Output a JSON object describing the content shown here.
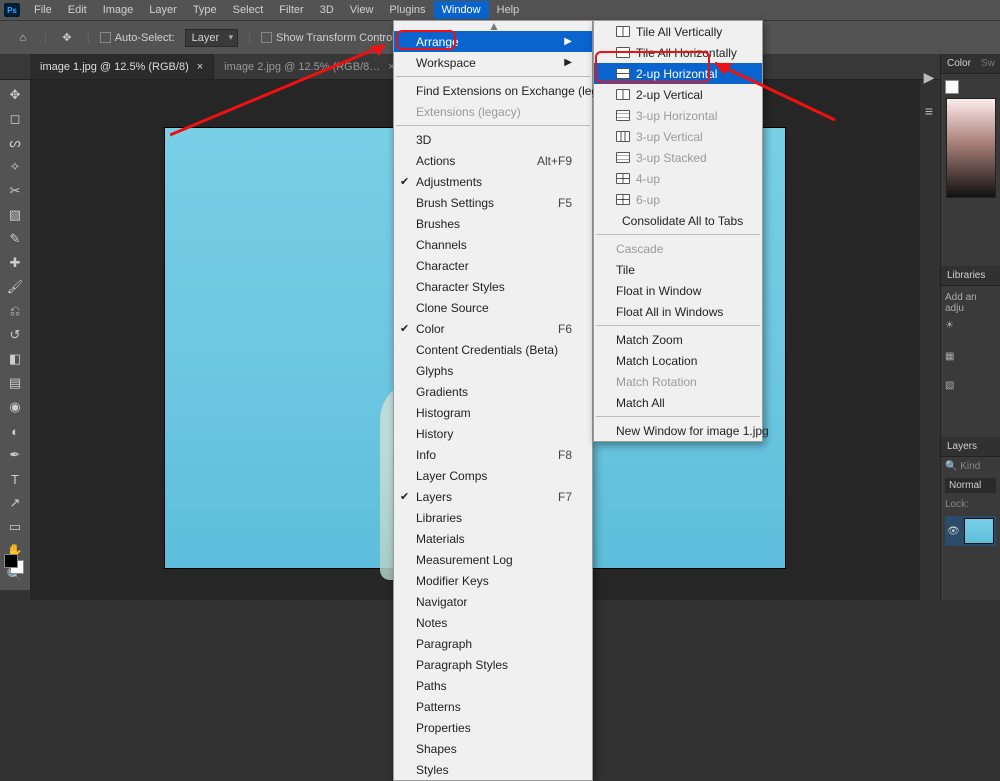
{
  "menubar": {
    "logo": "Ps",
    "items": [
      "File",
      "Edit",
      "Image",
      "Layer",
      "Type",
      "Select",
      "Filter",
      "3D",
      "View",
      "Plugins",
      "Window",
      "Help"
    ],
    "open_index": 10
  },
  "optbar": {
    "auto_select": "Auto-Select:",
    "select_target": "Layer",
    "show_transform": "Show Transform Controls"
  },
  "doctabs": [
    {
      "label": "image 1.jpg @ 12.5% (RGB/8)",
      "active": true
    },
    {
      "label": "image 2.jpg @ 12.5% (RGB/8…",
      "active": false
    }
  ],
  "window_menu": {
    "top": [
      {
        "label": "Arrange",
        "highlight": true,
        "submenu": true
      },
      {
        "label": "Workspace",
        "submenu": true
      }
    ],
    "ext": [
      {
        "label": "Find Extensions on Exchange (legacy)…"
      },
      {
        "label": "Extensions (legacy)",
        "disabled": true
      }
    ],
    "panels": [
      {
        "label": "3D"
      },
      {
        "label": "Actions",
        "shortcut": "Alt+F9"
      },
      {
        "label": "Adjustments",
        "checked": true
      },
      {
        "label": "Brush Settings",
        "shortcut": "F5"
      },
      {
        "label": "Brushes"
      },
      {
        "label": "Channels"
      },
      {
        "label": "Character"
      },
      {
        "label": "Character Styles"
      },
      {
        "label": "Clone Source"
      },
      {
        "label": "Color",
        "shortcut": "F6",
        "checked": true
      },
      {
        "label": "Content Credentials (Beta)"
      },
      {
        "label": "Glyphs"
      },
      {
        "label": "Gradients"
      },
      {
        "label": "Histogram"
      },
      {
        "label": "History"
      },
      {
        "label": "Info",
        "shortcut": "F8"
      },
      {
        "label": "Layer Comps"
      },
      {
        "label": "Layers",
        "shortcut": "F7",
        "checked": true
      },
      {
        "label": "Libraries"
      },
      {
        "label": "Materials"
      },
      {
        "label": "Measurement Log"
      },
      {
        "label": "Modifier Keys"
      },
      {
        "label": "Navigator"
      },
      {
        "label": "Notes"
      },
      {
        "label": "Paragraph"
      },
      {
        "label": "Paragraph Styles"
      },
      {
        "label": "Paths"
      },
      {
        "label": "Patterns"
      },
      {
        "label": "Properties"
      },
      {
        "label": "Shapes"
      },
      {
        "label": "Styles"
      }
    ]
  },
  "arrange_menu": {
    "layouts": [
      {
        "label": "Tile All Vertically",
        "icon": "split-v"
      },
      {
        "label": "Tile All Horizontally",
        "icon": "split-h"
      },
      {
        "label": "2-up Horizontal",
        "icon": "split-h",
        "highlight": true
      },
      {
        "label": "2-up Vertical",
        "icon": "split-v"
      },
      {
        "label": "3-up Horizontal",
        "icon": "grid3h",
        "disabled": true
      },
      {
        "label": "3-up Vertical",
        "icon": "grid3v",
        "disabled": true
      },
      {
        "label": "3-up Stacked",
        "icon": "grid3h",
        "disabled": true
      },
      {
        "label": "4-up",
        "icon": "grid4",
        "disabled": true
      },
      {
        "label": "6-up",
        "icon": "grid4",
        "disabled": true
      },
      {
        "label": "Consolidate All to Tabs",
        "icon": ""
      }
    ],
    "win": [
      {
        "label": "Cascade",
        "disabled": true
      },
      {
        "label": "Tile"
      },
      {
        "label": "Float in Window"
      },
      {
        "label": "Float All in Windows"
      }
    ],
    "match": [
      {
        "label": "Match Zoom"
      },
      {
        "label": "Match Location"
      },
      {
        "label": "Match Rotation",
        "disabled": true
      },
      {
        "label": "Match All"
      }
    ],
    "new_win": "New Window for image 1.jpg"
  },
  "right": {
    "tabs1": [
      "Color",
      "Sw"
    ],
    "libraries": "Libraries",
    "adjust": "Add an adju",
    "layers_tab": "Layers",
    "kind": "Kind",
    "blend": "Normal",
    "lock": "Lock:"
  }
}
